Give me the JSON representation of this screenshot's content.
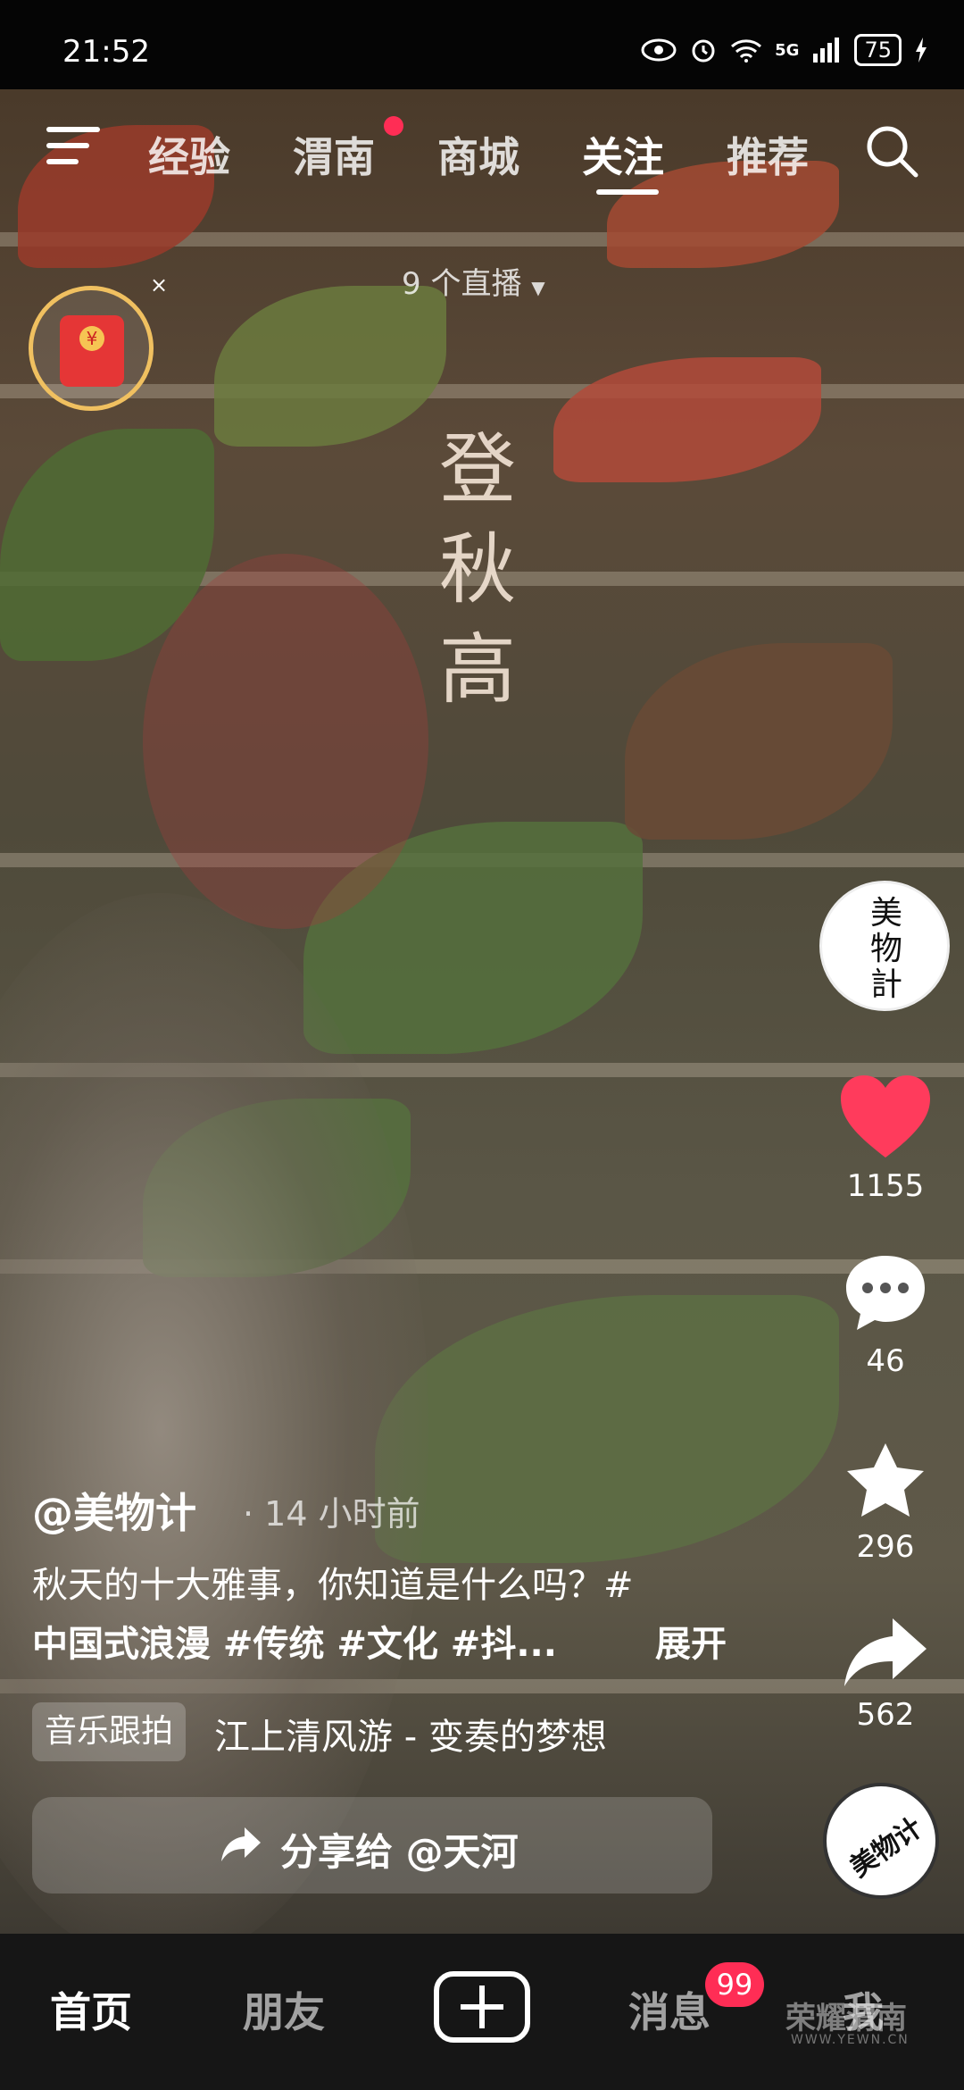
{
  "status_bar": {
    "time": "21:52",
    "network": "5G",
    "battery": "75"
  },
  "top_nav": {
    "tabs": [
      {
        "label": "经验"
      },
      {
        "label": "渭南"
      },
      {
        "label": "商城"
      },
      {
        "label": "关注"
      },
      {
        "label": "推荐"
      }
    ],
    "active_tab": "关注",
    "live_count": "9 个直播"
  },
  "video": {
    "overlay_title": [
      "登",
      "秋",
      "高"
    ],
    "author": "@美物计",
    "time_ago": "· 14 小时前",
    "description_line1": "秋天的十大雅事，你知道是什么吗？#",
    "description_line2": "中国式浪漫 #传统 #文化 #抖...",
    "expand_label": "展开",
    "music_tag": "音乐跟拍",
    "music_title": "江上清风游 - 变奏的梦想",
    "share_label": "分享给 @天河",
    "disc_text": "美物计"
  },
  "right_rail": {
    "avatar_text": "美物計",
    "likes": "1155",
    "comments": "46",
    "favorites": "296",
    "shares": "562",
    "like_color": "#ff3b5c"
  },
  "bottom_nav": {
    "home": "首页",
    "friends": "朋友",
    "messages": "消息",
    "messages_badge": "99",
    "me": "我"
  },
  "watermark": {
    "text": "荣耀渭南",
    "sub": "WWW.YEWN.CN"
  }
}
